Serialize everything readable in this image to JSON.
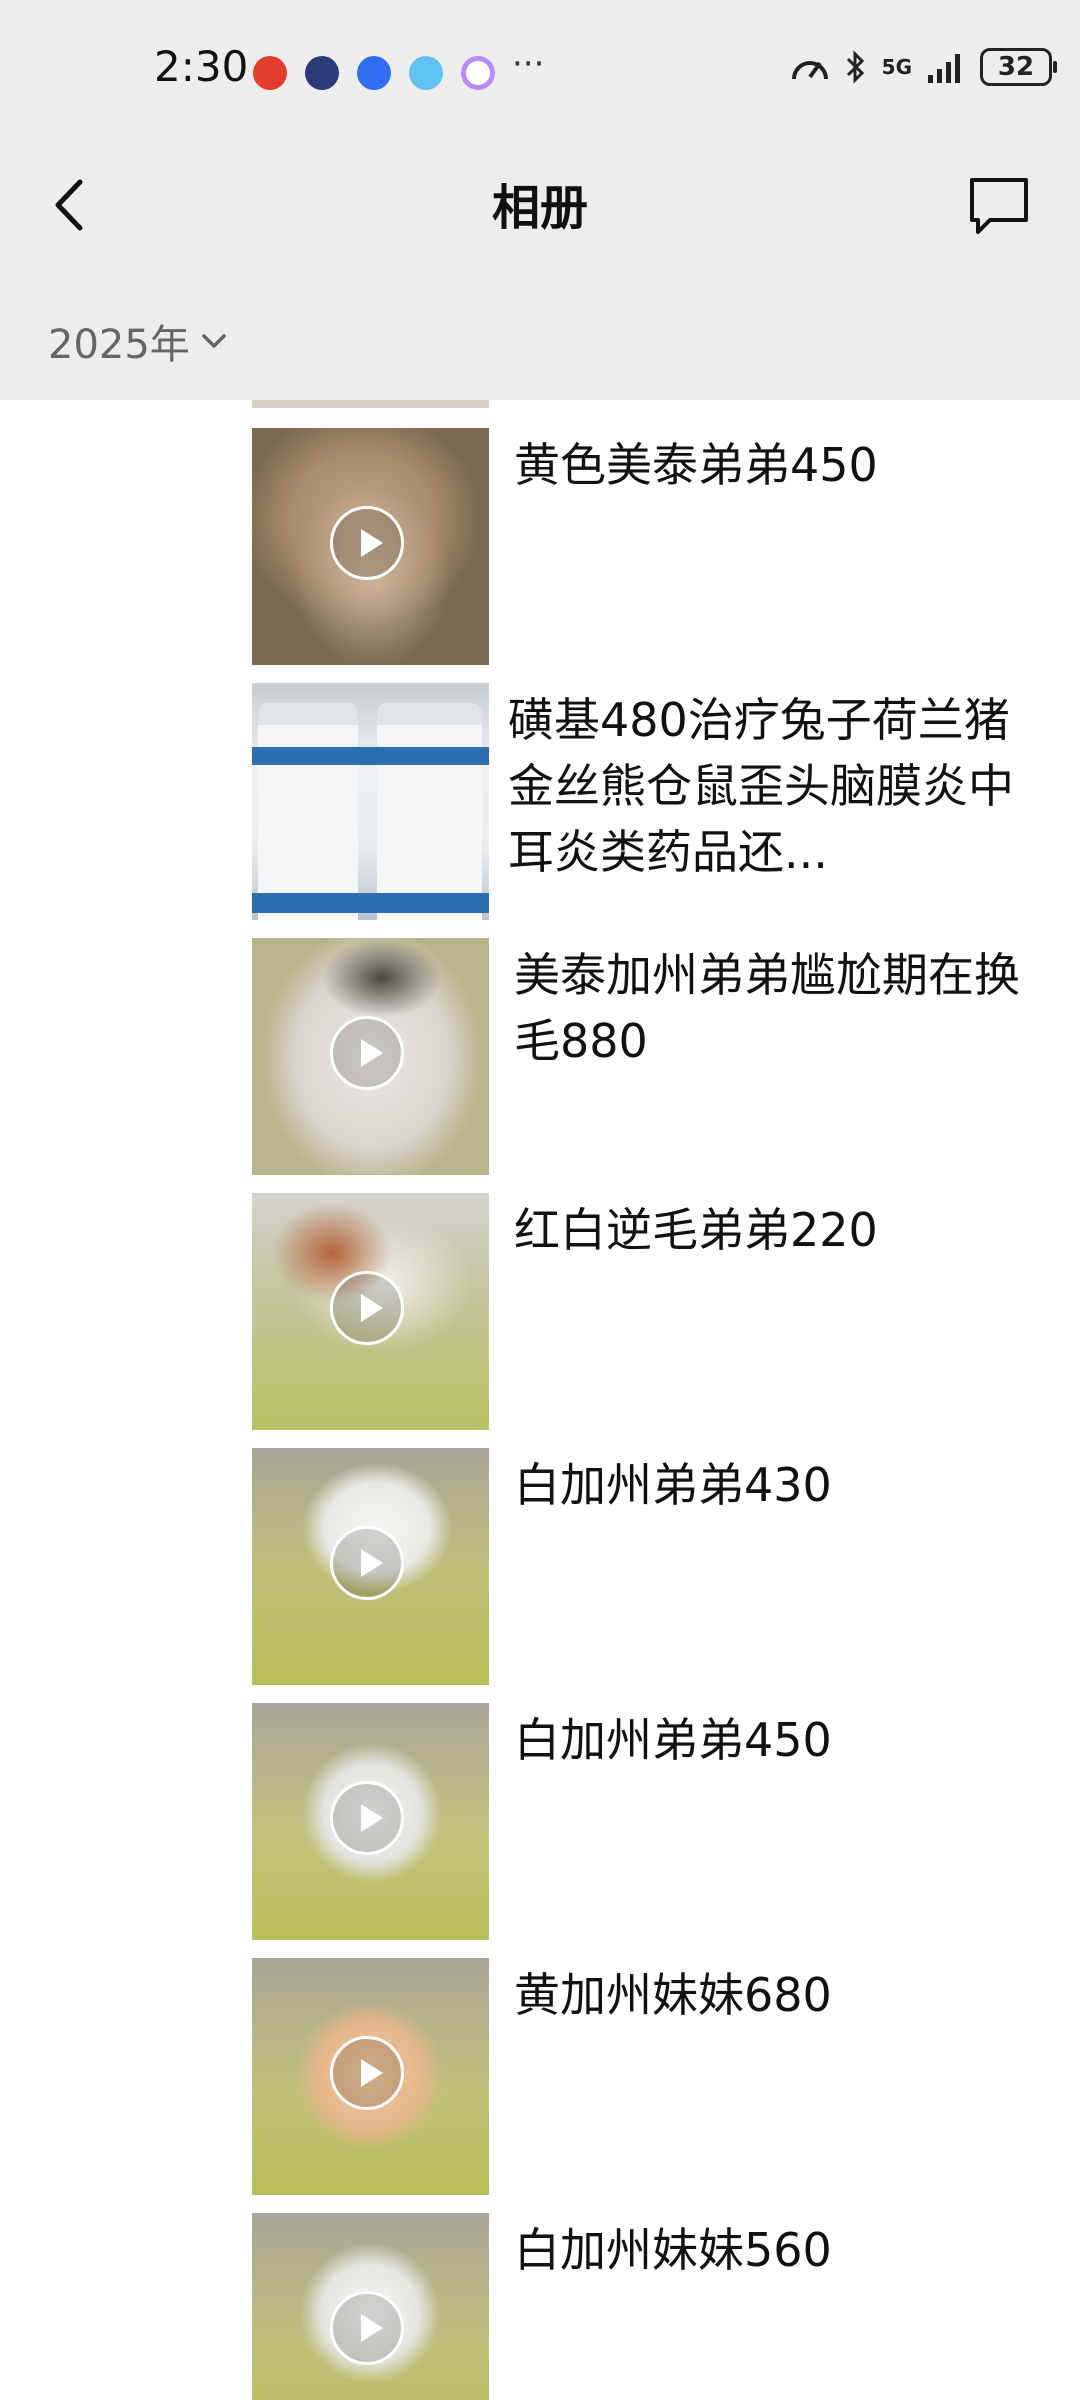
{
  "status_bar": {
    "time": "2:30",
    "network": "5G",
    "battery": "32",
    "more": "···"
  },
  "nav": {
    "title": "相册",
    "back_icon": "chevron-left-icon",
    "message_icon": "chat-bubble-icon"
  },
  "filter": {
    "year": "2025年",
    "icon": "chevron-down-icon"
  },
  "posts": [
    {
      "caption": "黄色美泰弟弟450",
      "is_video": true
    },
    {
      "caption": "磺基480治疗兔子荷兰猪金丝熊仓鼠歪头脑膜炎中耳炎类药品还...",
      "is_video": false
    },
    {
      "caption": "美泰加州弟弟尴尬期在换毛880",
      "is_video": true
    },
    {
      "caption": "红白逆毛弟弟220",
      "is_video": true
    },
    {
      "caption": "白加州弟弟430",
      "is_video": true
    },
    {
      "caption": "白加州弟弟450",
      "is_video": true
    },
    {
      "caption": "黄加州妹妹680",
      "is_video": true
    },
    {
      "caption": "白加州妹妹560",
      "is_video": true
    }
  ],
  "colors": {
    "header_bg": "#ededed",
    "text": "#111111"
  }
}
